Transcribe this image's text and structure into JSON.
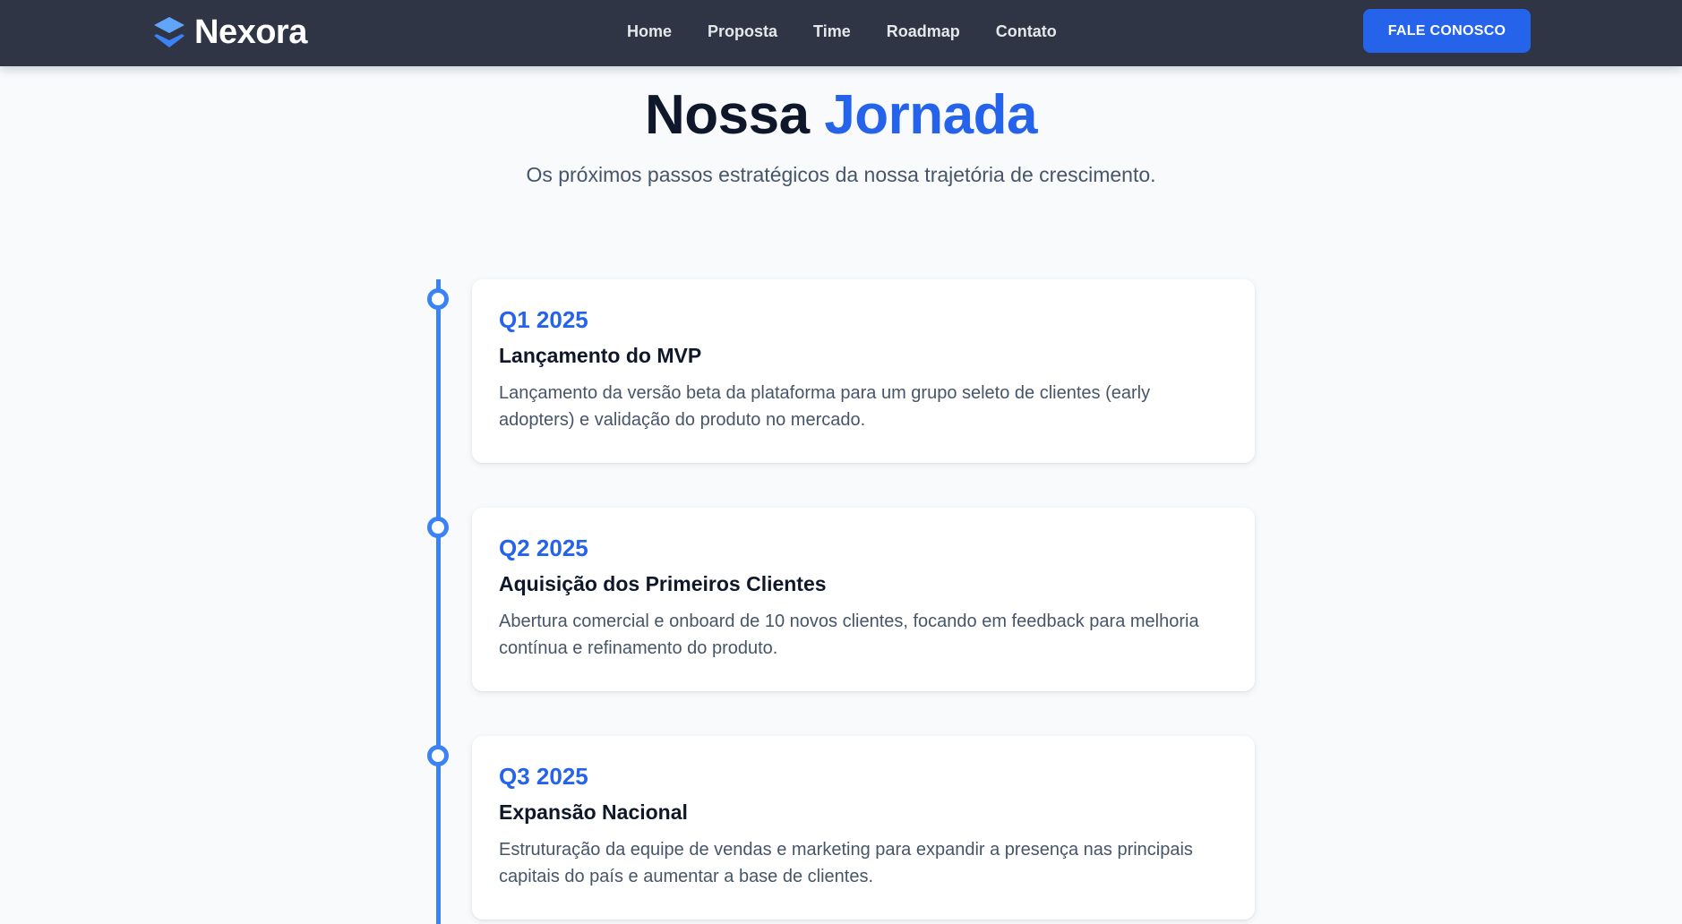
{
  "brand": {
    "name": "Nexora",
    "icon": "layers-logo-icon",
    "colors": {
      "primary": "#2563eb",
      "light": "#60a5fa"
    }
  },
  "nav": {
    "links": [
      {
        "label": "Home"
      },
      {
        "label": "Proposta"
      },
      {
        "label": "Time"
      },
      {
        "label": "Roadmap"
      },
      {
        "label": "Contato"
      }
    ],
    "cta_label": "FALE CONOSCO"
  },
  "section": {
    "title_main": "Nossa",
    "title_accent": "Jornada",
    "subtitle": "Os próximos passos estratégicos da nossa trajetória de crescimento."
  },
  "timeline": {
    "accent_color": "#3b82f6",
    "items": [
      {
        "quarter": "Q1 2025",
        "title": "Lançamento do MVP",
        "description": "Lançamento da versão beta da plataforma para um grupo seleto de clientes (early adopters) e validação do produto no mercado."
      },
      {
        "quarter": "Q2 2025",
        "title": "Aquisição dos Primeiros Clientes",
        "description": "Abertura comercial e onboard de 10 novos clientes, focando em feedback para melhoria contínua e refinamento do produto."
      },
      {
        "quarter": "Q3 2025",
        "title": "Expansão Nacional",
        "description": "Estruturação da equipe de vendas e marketing para expandir a presença nas principais capitais do país e aumentar a base de clientes."
      }
    ]
  }
}
